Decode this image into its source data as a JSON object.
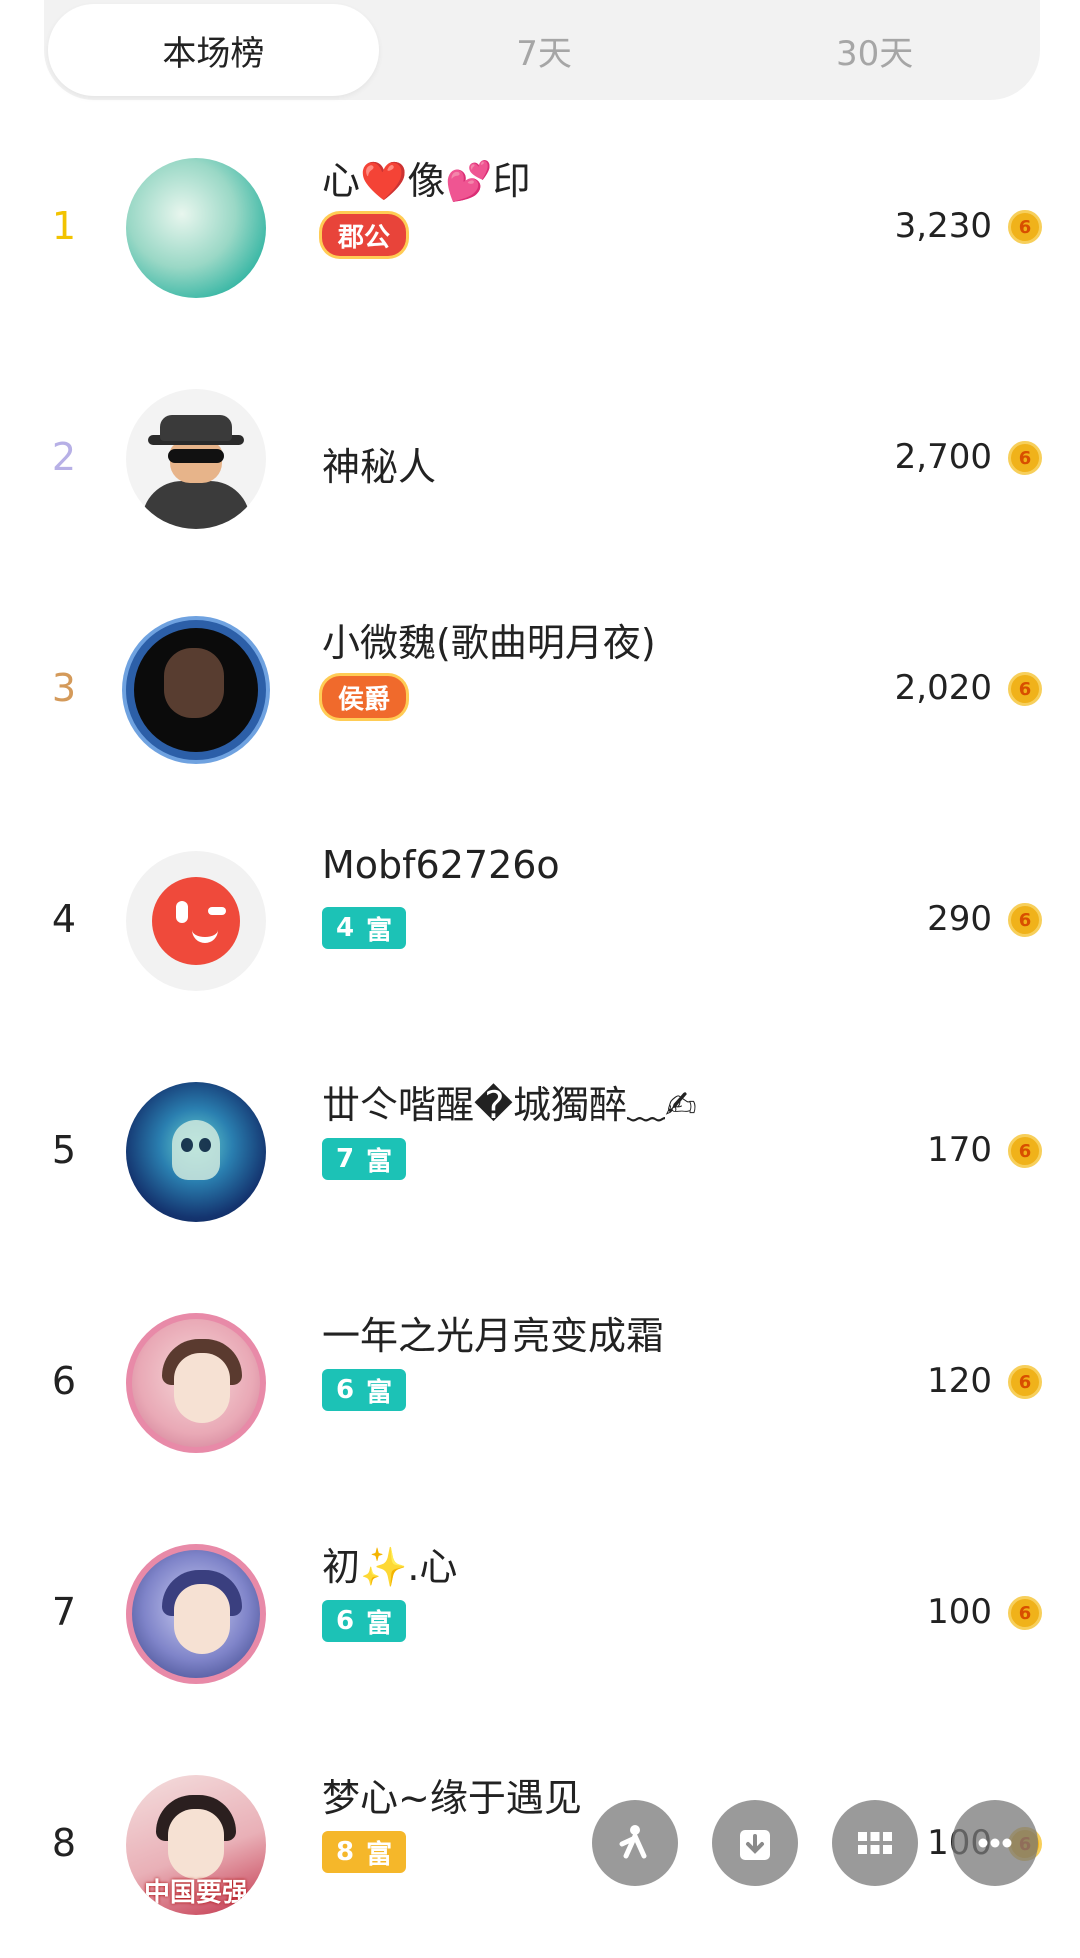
{
  "tabs": [
    {
      "label": "本场榜",
      "active": true
    },
    {
      "label": "7天",
      "active": false
    },
    {
      "label": "30天",
      "active": false
    }
  ],
  "rows": [
    {
      "rank": "1",
      "name": "心❤️像💕印",
      "badge": "郡公",
      "amount": "3,230"
    },
    {
      "rank": "2",
      "name": "神秘人",
      "badge": "",
      "amount": "2,700"
    },
    {
      "rank": "3",
      "name": "小微魏(歌曲明月夜)",
      "badge": "侯爵",
      "amount": "2,020"
    },
    {
      "rank": "4",
      "name": "Mobf62726o",
      "badge_level": "4",
      "badge_text": "富",
      "amount": "290"
    },
    {
      "rank": "5",
      "name": "丗仒喈醒�城獨醉﹏✍",
      "badge_level": "7",
      "badge_text": "富",
      "amount": "170"
    },
    {
      "rank": "6",
      "name": "一年之光月亮变成霜",
      "badge_level": "6",
      "badge_text": "富",
      "amount": "120"
    },
    {
      "rank": "7",
      "name": "初✨.心",
      "badge_level": "6",
      "badge_text": "富",
      "amount": "100"
    },
    {
      "rank": "8",
      "name": "梦心~缘于遇见",
      "badge_level": "8",
      "badge_text": "富",
      "amount": "100",
      "avatar_caption": "中国要强"
    }
  ],
  "coin_glyph": "6",
  "colors": {
    "rank1": "#f2c300",
    "rank2": "#b7b0e6",
    "rank3": "#d49a5a",
    "rich_badge": "#1cc2b6",
    "gold_badge": "#f5b72a",
    "coin": "#f0b21a"
  },
  "fab_icons": [
    "sparkle-icon",
    "download-icon",
    "grid-icon",
    "more-icon"
  ]
}
